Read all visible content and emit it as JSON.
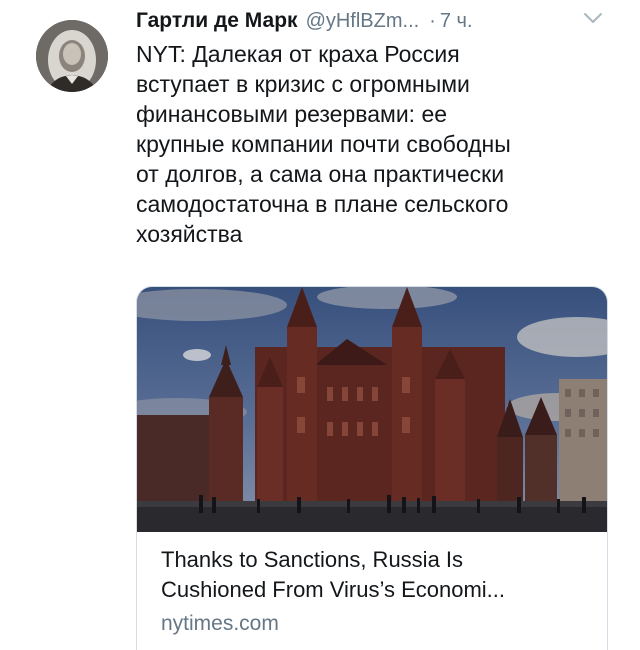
{
  "tweet": {
    "author_name": "Гартли де Марк",
    "author_handle": "@yHflBZm...",
    "separator": "·",
    "time": "7 ч.",
    "text": "NYT: Далекая от краха Россия\nвступает в кризис с огромными\nфинансовыми резервами: ее\nкрупные компании почти свободны\nот долгов, а сама она практически\nсамодостаточна в плане сельского\nхозяйства"
  },
  "card": {
    "title": "Thanks to Sanctions, Russia Is\nCushioned From Virus’s Economi...",
    "domain": "nytimes.com"
  },
  "icons": {
    "menu": "chevron-down-icon",
    "avatar": "portrait-avatar"
  },
  "colors": {
    "text": "#14171a",
    "secondary": "#657786",
    "card_border": "#d4dde3"
  }
}
